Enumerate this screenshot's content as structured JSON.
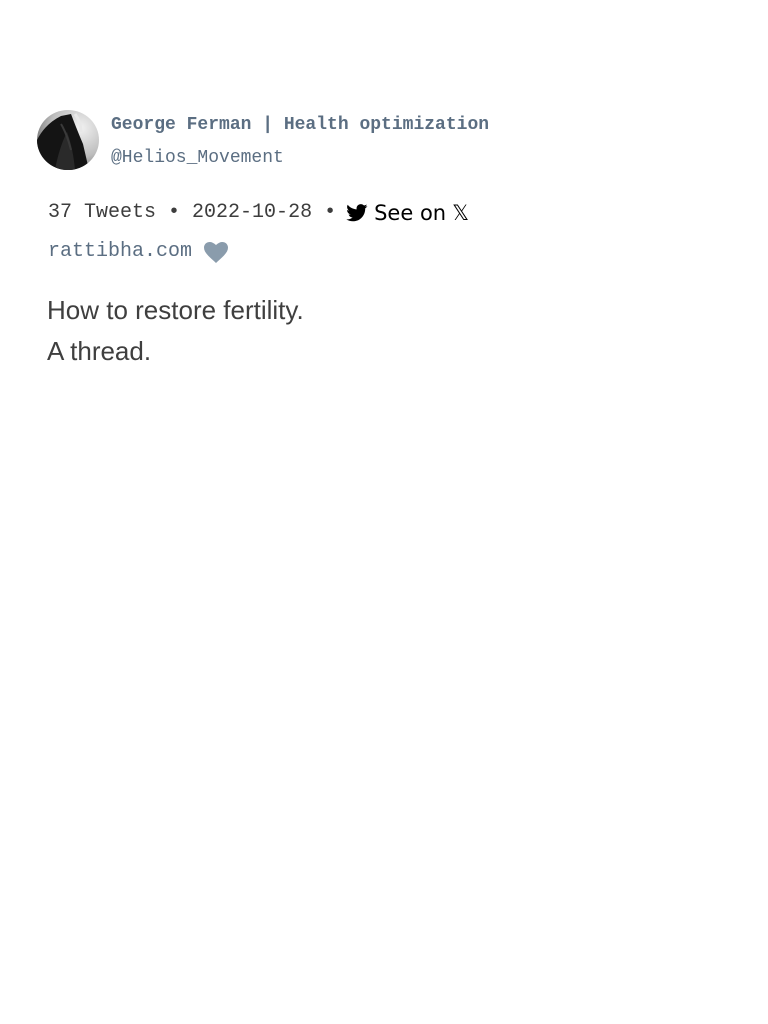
{
  "author": {
    "display_name": "George Ferman | Health optimization",
    "handle": "@Helios_Movement",
    "avatar_icon": "profile-photo-avatar"
  },
  "meta": {
    "tweet_count": "37 Tweets",
    "separator": "•",
    "date": "2022-10-28",
    "see_on_label": "See on",
    "x_glyph": "𝕏",
    "twitter_icon": "twitter-bird-icon",
    "site_link": "rattibha.com",
    "heart_icon": "heart-icon",
    "heart_color": "#8a9cac"
  },
  "thread": {
    "lines": [
      "How to restore fertility.",
      "A thread."
    ]
  }
}
